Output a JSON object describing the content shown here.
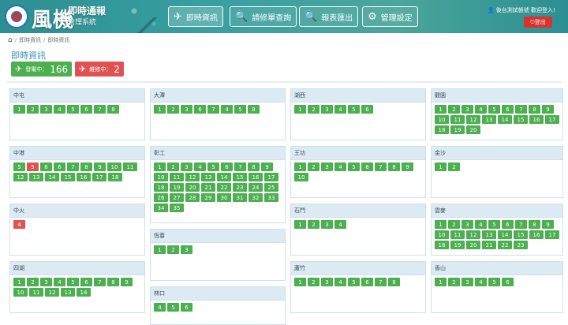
{
  "header": {
    "brand_main": "風機",
    "brand_sub1": "即時通報",
    "brand_sub2": "管理系統",
    "nav": [
      {
        "label": "即時資訊",
        "icon": "✈"
      },
      {
        "label": "請修單查詢",
        "icon": "🔍"
      },
      {
        "label": "報表匯出",
        "icon": "🔍"
      },
      {
        "label": "管理設定",
        "icon": "⚙"
      }
    ],
    "user_text": "後台測試帳號 歡迎登入!",
    "user_icon": "👤",
    "logout_label": "登出",
    "logout_icon": "⎋"
  },
  "breadcrumb": [
    "即時資訊",
    "即時資訊"
  ],
  "page_title": "即時資訊",
  "counts": {
    "running_label": "發電中：",
    "running_value": "166",
    "maint_label": "維修中：",
    "maint_value": "2",
    "colors": {
      "running": "#4caf50",
      "maint": "#e05252"
    }
  },
  "panels": [
    {
      "name": "中屯",
      "items": [
        "1",
        "2",
        "3",
        "4",
        "5",
        "6",
        "7",
        "8"
      ],
      "red": []
    },
    {
      "name": "大潭",
      "items": [
        "1",
        "2",
        "3",
        "6",
        "7",
        "4",
        "5",
        "8"
      ],
      "red": []
    },
    {
      "name": "湖西",
      "items": [
        "1",
        "2",
        "3",
        "4",
        "5",
        "6"
      ],
      "red": []
    },
    {
      "name": "觀園",
      "items": [
        "1",
        "2",
        "3",
        "4",
        "5",
        "6",
        "7",
        "8",
        "9",
        "10",
        "11",
        "12",
        "13",
        "14",
        "15",
        "16",
        "17",
        "18",
        "19",
        "20"
      ],
      "red": []
    },
    {
      "name": "中港",
      "items": [
        "5",
        "5",
        "6",
        "6",
        "7",
        "8",
        "9",
        "10",
        "11",
        "12",
        "13",
        "14",
        "15",
        "16",
        "17",
        "18"
      ],
      "red": [
        1
      ]
    },
    {
      "name": "彰工",
      "items": [
        "1",
        "2",
        "3",
        "4",
        "5",
        "6",
        "7",
        "8",
        "9",
        "10",
        "11",
        "12",
        "13",
        "14",
        "15",
        "16",
        "17",
        "18",
        "19",
        "20",
        "21",
        "22",
        "23",
        "24",
        "25",
        "26",
        "27",
        "28",
        "29",
        "30",
        "31",
        "32",
        "33",
        "34",
        "35"
      ],
      "red": []
    },
    {
      "name": "王功",
      "items": [
        "1",
        "2",
        "3",
        "4",
        "5",
        "6",
        "7",
        "8",
        "9",
        "10"
      ],
      "red": []
    },
    {
      "name": "金沙",
      "items": [
        "1",
        "2"
      ],
      "red": []
    },
    {
      "name": "中火",
      "items": [
        "4"
      ],
      "red": [
        0
      ]
    },
    {
      "name": "恆春",
      "items": [
        "1",
        "2",
        "3"
      ],
      "red": []
    },
    {
      "name": "石門",
      "items": [
        "1",
        "2",
        "3",
        "4"
      ],
      "red": []
    },
    {
      "name": "雲麥",
      "items": [
        "1",
        "2",
        "3",
        "4",
        "5",
        "6",
        "7",
        "8",
        "9",
        "10",
        "11",
        "12",
        "13",
        "14",
        "15",
        "16",
        "17",
        "18",
        "19",
        "20",
        "21",
        "22",
        "23"
      ],
      "red": []
    },
    {
      "name": "四湖",
      "items": [
        "1",
        "2",
        "3",
        "4",
        "5",
        "6",
        "7",
        "8",
        "9",
        "10",
        "11",
        "12",
        "13",
        "14"
      ],
      "red": []
    },
    {
      "name": "林口",
      "items": [
        "4",
        "5",
        "6"
      ],
      "red": []
    },
    {
      "name": "蘆竹",
      "items": [
        "1",
        "2",
        "3",
        "4",
        "5",
        "6",
        "7",
        "8"
      ],
      "red": []
    },
    {
      "name": "香山",
      "items": [
        "1",
        "2",
        "3",
        "4",
        "5",
        "6"
      ],
      "red": []
    }
  ]
}
